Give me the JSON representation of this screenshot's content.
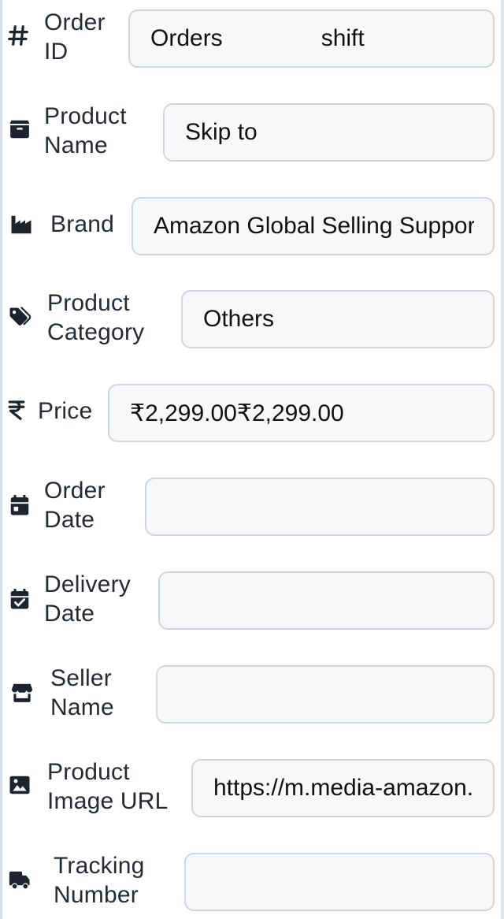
{
  "fields": [
    {
      "label_line1": "Order",
      "label_line2": "ID",
      "value": "Orders               shift",
      "icon": "hash-icon"
    },
    {
      "label_line1": "Product",
      "label_line2": "Name",
      "value": "Skip to",
      "icon": "box-icon"
    },
    {
      "label_line1": "Brand",
      "label_line2": "",
      "value": "Amazon Global Selling Support",
      "icon": "industry-icon"
    },
    {
      "label_line1": "Product",
      "label_line2": "Category",
      "value": "Others",
      "icon": "tags-icon"
    },
    {
      "label_line1": "Price",
      "label_line2": "",
      "value": "₹2,299.00₹2,299.00",
      "icon": "rupee-icon"
    },
    {
      "label_line1": "Order",
      "label_line2": "Date",
      "value": "",
      "icon": "calendar-icon"
    },
    {
      "label_line1": "Delivery",
      "label_line2": "Date",
      "value": "",
      "icon": "calendar-check-icon"
    },
    {
      "label_line1": "Seller",
      "label_line2": "Name",
      "value": "",
      "icon": "store-icon"
    },
    {
      "label_line1": "Product",
      "label_line2": "Image URL",
      "value": "https://m.media-amazon.com/images",
      "icon": "image-icon"
    },
    {
      "label_line1": "Tracking",
      "label_line2": "Number",
      "value": "",
      "icon": "truck-icon"
    }
  ],
  "colors": {
    "field_bg": "#f7f8fa",
    "field_border": "#d2d5db",
    "label_text": "#262a36",
    "icon": "#1f2330"
  }
}
